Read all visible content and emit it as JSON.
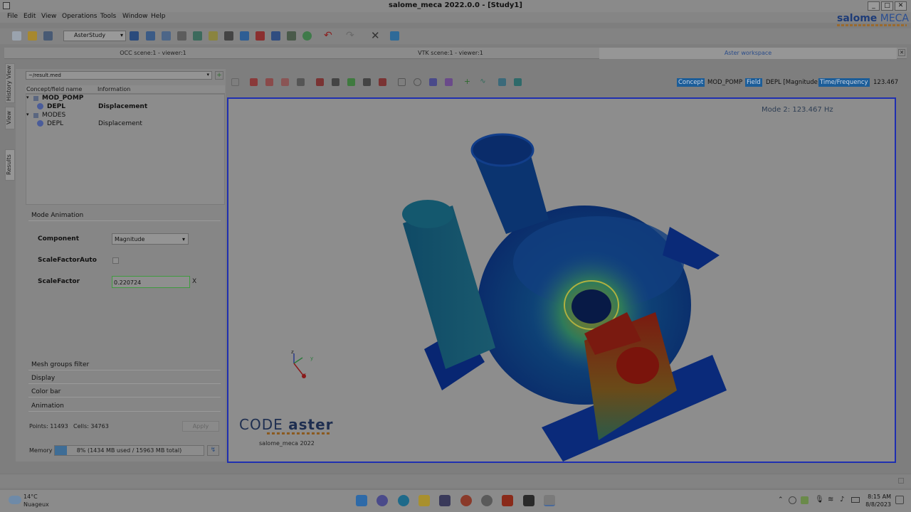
{
  "window": {
    "title": "salome_meca 2022.0.0 - [Study1]",
    "controls": [
      "_",
      "□",
      "✕"
    ]
  },
  "menu": [
    "File",
    "Edit",
    "View",
    "Operations",
    "Tools",
    "Window",
    "Help"
  ],
  "logo": {
    "brand": "salome",
    "product": "MECA"
  },
  "toolbar": {
    "module": "AsterStudy"
  },
  "tabs": [
    "OCC scene:1 - viewer:1",
    "VTK scene:1 - viewer:1",
    "Aster workspace"
  ],
  "vertical_tabs": [
    "History View",
    "View",
    "Results"
  ],
  "results": {
    "file": "~/result.med",
    "columns": [
      "Concept/field name",
      "Information"
    ],
    "tree": [
      {
        "name": "MOD_POMP",
        "info": "",
        "bold": true
      },
      {
        "name": "DEPL",
        "info": "Displacement",
        "bold": true
      },
      {
        "name": "MODES",
        "info": "",
        "bold": false
      },
      {
        "name": "DEPL",
        "info": "Displacement",
        "bold": false
      }
    ]
  },
  "mode_animation": {
    "header": "Mode Animation",
    "component_label": "Component",
    "component_value": "Magnitude",
    "scale_auto_label": "ScaleFactorAuto",
    "scale_label": "ScaleFactor",
    "scale_value": "0.220724",
    "clear": "X"
  },
  "sections": [
    "Mesh groups filter",
    "Display",
    "Color bar",
    "Animation"
  ],
  "stats": {
    "points": "Points:  11493",
    "cells": "Cells:  34763",
    "apply": "Apply"
  },
  "memory": {
    "label": "Memory",
    "text": "8% (1434 MB used / 15963 MB total)",
    "percent": 8
  },
  "viewer_info": {
    "concept_tag": "Concept",
    "concept": "MOD_POMP",
    "field_tag": "Field",
    "field": "DEPL [Magnitude]",
    "time_tag": "Time/Frequency",
    "time": "123.467",
    "mode_label": "Mode 2: 123.467 Hz"
  },
  "axes": {
    "z": "z",
    "y": "y",
    "x": "x"
  },
  "watermark": {
    "code": "CODE",
    "aster": "aster",
    "sub": "salome_meca 2022"
  },
  "taskbar": {
    "weather_temp": "14°C",
    "weather_desc": "Nuageux",
    "time": "8:15 AM",
    "date": "8/8/2023"
  }
}
